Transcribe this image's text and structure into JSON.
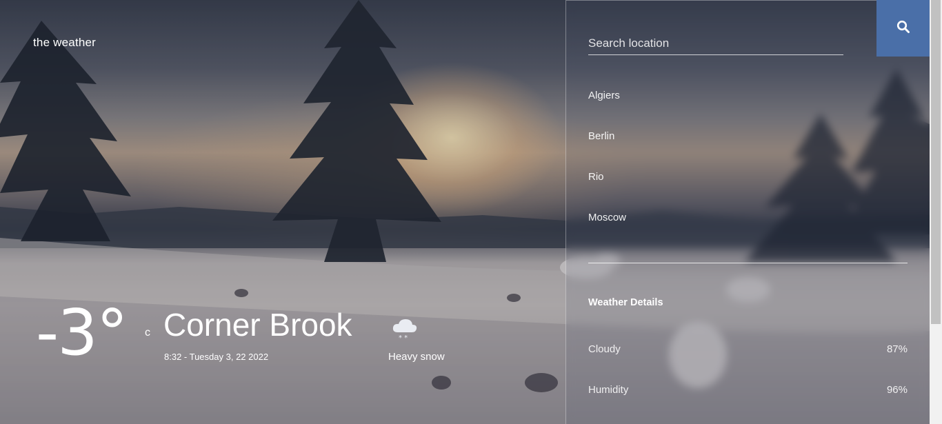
{
  "app": {
    "brand": "the weather"
  },
  "current": {
    "temperature": "-3°",
    "unit": "c",
    "city": "Corner Brook",
    "datetime": "8:32 - Tuesday 3, 22 2022",
    "condition": "Heavy snow",
    "condition_icon": "snow-cloud-icon"
  },
  "search": {
    "placeholder": "Search location",
    "value": "",
    "button_icon": "search-icon"
  },
  "locations": [
    "Algiers",
    "Berlin",
    "Rio",
    "Moscow"
  ],
  "details": {
    "title": "Weather Details",
    "rows": [
      {
        "label": "Cloudy",
        "value": "87%"
      },
      {
        "label": "Humidity",
        "value": "96%"
      }
    ]
  },
  "colors": {
    "accent": "#4a6fa8"
  }
}
